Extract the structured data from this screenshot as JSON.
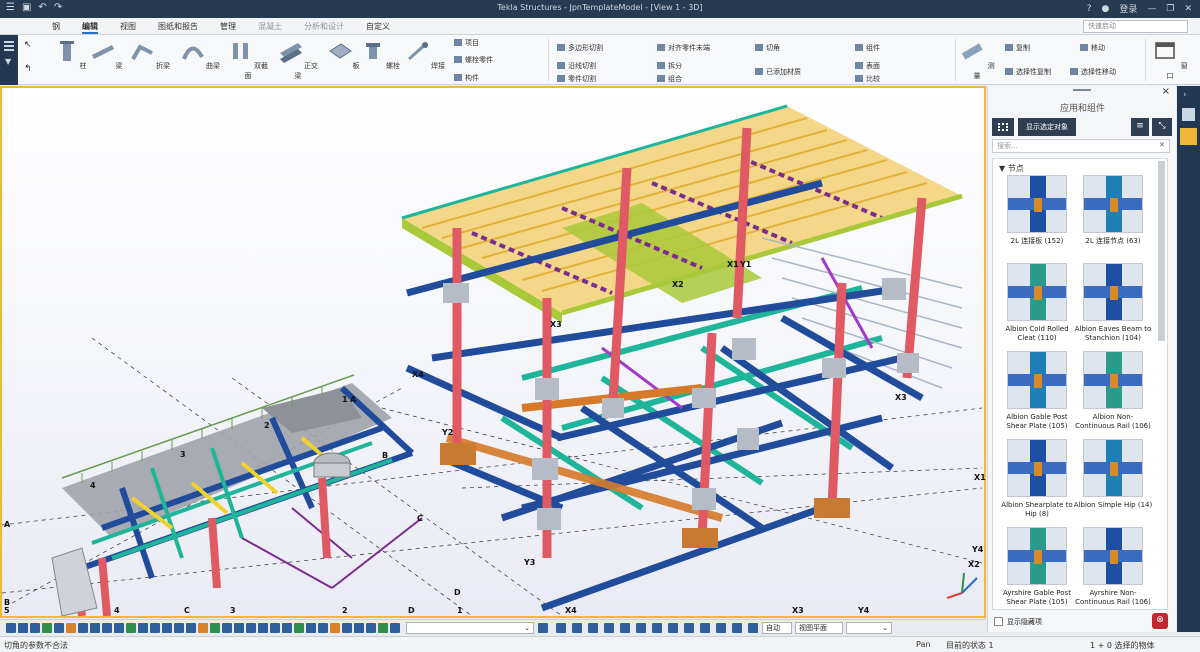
{
  "app": {
    "title": "Tekla Structures - JpnTemplateModel - [View 1 - 3D]",
    "help": "?",
    "login": "登录"
  },
  "tabs": [
    {
      "label": "钢",
      "state": "normal"
    },
    {
      "label": "编辑",
      "state": "active"
    },
    {
      "label": "视图",
      "state": "normal"
    },
    {
      "label": "图纸和报告",
      "state": "normal"
    },
    {
      "label": "管理",
      "state": "normal"
    },
    {
      "label": "混凝土",
      "state": "dim"
    },
    {
      "label": "分析和设计",
      "state": "dim"
    },
    {
      "label": "自定义",
      "state": "normal"
    }
  ],
  "search": {
    "placeholder": "快速启动"
  },
  "ribbon": {
    "large": [
      {
        "label": "柱",
        "icon": "column-icon"
      },
      {
        "label": "梁",
        "icon": "beam-icon"
      },
      {
        "label": "折梁",
        "icon": "polybeam-icon"
      },
      {
        "label": "曲梁",
        "icon": "curved-beam-icon"
      },
      {
        "label": "双截面",
        "icon": "twin-profile-icon"
      },
      {
        "label": "正交梁",
        "icon": "orthogonal-beam-icon"
      },
      {
        "label": "板",
        "icon": "plate-icon"
      },
      {
        "label": "螺栓",
        "icon": "bolt-icon"
      },
      {
        "label": "焊接",
        "icon": "weld-icon"
      }
    ],
    "small": {
      "item": "项目",
      "bolt_part": "螺栓零件",
      "component": "构件",
      "polygon_cut": "多边形切割",
      "cut_line": "沿线切割",
      "part_cut": "零件切割",
      "fit_part_end": "对齐零件末端",
      "split": "拆分",
      "combine": "组合",
      "chamfer": "切角",
      "add_weld": "已添加材质",
      "assembly": "组件",
      "surface": "表面",
      "compare": "比较",
      "measure": "测量",
      "copy": "复制",
      "move": "移动",
      "copy_special": "选择性复制",
      "move_special": "选择性移动",
      "window": "窗口"
    }
  },
  "viewport": {
    "grid_labels": {
      "x1": "X1",
      "x2": "X2",
      "x3": "X3",
      "x4": "X4",
      "y1": "Y1",
      "y2": "Y2",
      "y3": "Y3",
      "y4": "Y4",
      "a": "A",
      "b": "B",
      "c": "C",
      "d": "D",
      "n1": "1",
      "n2": "2",
      "n3": "3",
      "n4": "4",
      "n5": "5"
    }
  },
  "panel": {
    "title": "应用和组件",
    "show_selected": "显示选定对象",
    "search_placeholder": "搜索...",
    "category": "节点",
    "items": [
      {
        "label": "2L 连接板 (152)"
      },
      {
        "label": "2L 连接节点 (63)"
      },
      {
        "label": "Albion Cold Rolled Cleat (110)"
      },
      {
        "label": "Albion Eaves Beam to Stanchion (104)"
      },
      {
        "label": "Albion Gable Post Shear Plate (105)"
      },
      {
        "label": "Albion Non-Continuous Rail (106)"
      },
      {
        "label": "Albion Shearplate to Hip (8)"
      },
      {
        "label": "Albion Simple Hip (14)"
      },
      {
        "label": "Ayrshire Gable Post Shear Plate (105)"
      },
      {
        "label": "Ayrshire Non-Continuous Rail (106)"
      }
    ],
    "show_hidden": "显示隐藏项"
  },
  "bottombar": {
    "dropdown1": "",
    "mode": "自动",
    "plane": "视图平面"
  },
  "status": {
    "left": "切角的参数不合法",
    "pan": "Pan",
    "phase": "目前的状态 1",
    "selection": "1 + 0 选择的物体"
  },
  "colors": {
    "column": "#e05a63",
    "beam_blue": "#214c9c",
    "beam_teal": "#1fb59a",
    "purlin_yellow": "#f0c24a",
    "roof_green": "#a9c93a",
    "purple": "#7b2d8f",
    "orange": "#d67a2a",
    "accent": "#f0b73a",
    "dark_chrome": "#223752"
  }
}
